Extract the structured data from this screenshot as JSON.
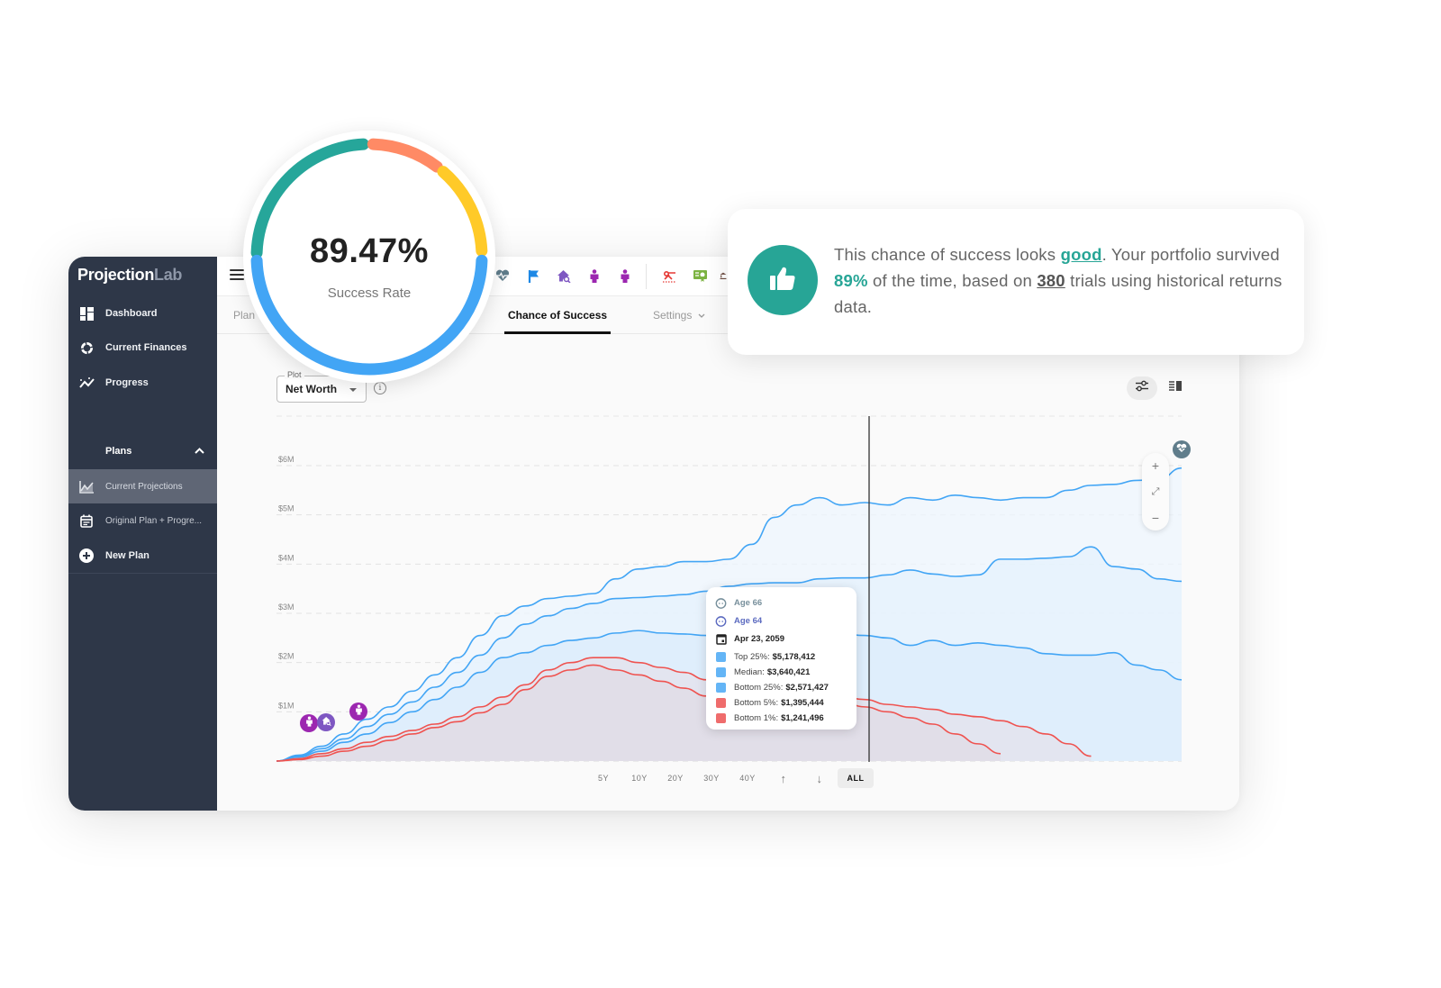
{
  "app": {
    "brand_main": "Projection",
    "brand_accent": "Lab"
  },
  "sidebar": {
    "items": [
      {
        "label": "Dashboard",
        "icon": "dashboard-icon"
      },
      {
        "label": "Current Finances",
        "icon": "donut-icon"
      },
      {
        "label": "Progress",
        "icon": "progress-icon"
      }
    ],
    "plans_header": "Plans",
    "plans": [
      {
        "label": "Current Projections",
        "icon": "chart-area-icon",
        "active": true
      },
      {
        "label": "Original Plan + Progre...",
        "icon": "calendar-icon",
        "active": false
      },
      {
        "label": "New Plan",
        "icon": "plus-circle-icon",
        "active": false
      }
    ]
  },
  "toolbar": {
    "icons": [
      "heart-pulse-icon",
      "flag-icon",
      "house-search-icon",
      "person-icon",
      "person-icon",
      "scissors-icon",
      "certificate-icon"
    ]
  },
  "tabs": [
    {
      "label": "Plan",
      "active": false
    },
    {
      "label": "Chance of Success",
      "active": true
    },
    {
      "label": "Settings",
      "active": false
    }
  ],
  "plot_select": {
    "legend": "Plot",
    "value": "Net Worth"
  },
  "gauge": {
    "value": "89.47%",
    "label": "Success Rate",
    "segments": [
      {
        "color": "#26a69a",
        "name": "teal"
      },
      {
        "color": "#ff8a65",
        "name": "orange"
      },
      {
        "color": "#ffca28",
        "name": "yellow"
      },
      {
        "color": "#42a5f5",
        "name": "blue"
      }
    ]
  },
  "message": {
    "part1": "This chance of success looks ",
    "rating": "good",
    "part2": ". Your portfolio survived ",
    "percent": "89%",
    "part3": " of the time, based on ",
    "trials": "380",
    "part4": " trials using historical returns data."
  },
  "range_buttons": [
    {
      "label": "5Y",
      "active": false
    },
    {
      "label": "10Y",
      "active": false
    },
    {
      "label": "20Y",
      "active": false
    },
    {
      "label": "30Y",
      "active": false
    },
    {
      "label": "40Y",
      "active": false
    },
    {
      "label": "↑",
      "active": false
    },
    {
      "label": "↓",
      "active": false
    },
    {
      "label": "ALL",
      "active": true
    }
  ],
  "zoom_controls": {
    "plus": "+",
    "fit": "⤢",
    "minus": "−"
  },
  "tooltip": {
    "age1": "Age 66",
    "age2": "Age 64",
    "date": "Apr 23, 2059",
    "rows": [
      {
        "label": "Top 25%:",
        "value": "$5,178,412",
        "color": "#64b5f6"
      },
      {
        "label": "Median:",
        "value": "$3,640,421",
        "color": "#64b5f6"
      },
      {
        "label": "Bottom 25%:",
        "value": "$2,571,427",
        "color": "#64b5f6"
      },
      {
        "label": "Bottom 5%:",
        "value": "$1,395,444",
        "color": "#ef6c6c"
      },
      {
        "label": "Bottom 1%:",
        "value": "$1,241,496",
        "color": "#ef6c6c"
      }
    ]
  },
  "chart_data": {
    "type": "area",
    "title": "",
    "xlabel": "",
    "ylabel": "Net Worth",
    "ylim": [
      0,
      6000000
    ],
    "yticks": [
      "$1M",
      "$2M",
      "$3M",
      "$4M",
      "$5M",
      "$6M"
    ],
    "ytick_values": [
      1000000,
      2000000,
      3000000,
      4000000,
      5000000,
      6000000
    ],
    "grid": true,
    "cursor_index": 26,
    "series": [
      {
        "name": "Top 25%",
        "color": "#42a5f5",
        "values": [
          0,
          0.12,
          0.3,
          0.55,
          0.85,
          1.1,
          1.42,
          1.75,
          2.1,
          2.55,
          2.95,
          3.15,
          3.3,
          3.35,
          3.4,
          3.7,
          3.9,
          3.95,
          4.05,
          4.05,
          4.1,
          4.4,
          4.95,
          5.2,
          5.35,
          5.2,
          5.25,
          5.2,
          5.35,
          5.3,
          5.4,
          5.35,
          5.3,
          5.35,
          5.35,
          5.5,
          5.6,
          5.62,
          5.7,
          5.72,
          5.95
        ]
      },
      {
        "name": "Median",
        "color": "#42a5f5",
        "values": [
          0,
          0.1,
          0.25,
          0.45,
          0.7,
          0.95,
          1.2,
          1.5,
          1.8,
          2.15,
          2.5,
          2.78,
          2.95,
          3.1,
          3.2,
          3.3,
          3.32,
          3.35,
          3.38,
          3.45,
          3.55,
          3.6,
          3.62,
          3.62,
          3.7,
          3.72,
          3.72,
          3.78,
          3.88,
          3.8,
          3.75,
          3.78,
          4.1,
          4.1,
          4.12,
          4.15,
          4.35,
          3.95,
          3.9,
          3.7,
          3.65
        ]
      },
      {
        "name": "Bottom 25%",
        "color": "#42a5f5",
        "values": [
          0,
          0.08,
          0.2,
          0.38,
          0.55,
          0.78,
          1.0,
          1.25,
          1.5,
          1.8,
          2.1,
          2.2,
          2.35,
          2.45,
          2.5,
          2.6,
          2.65,
          2.6,
          2.58,
          2.55,
          2.55,
          2.6,
          2.62,
          2.58,
          2.6,
          2.58,
          2.55,
          2.5,
          2.35,
          2.45,
          2.35,
          2.4,
          2.35,
          2.3,
          2.18,
          2.15,
          2.15,
          2.2,
          1.95,
          1.85,
          1.65
        ]
      },
      {
        "name": "Bottom 5%",
        "color": "#ef5350",
        "values": [
          0,
          0.05,
          0.15,
          0.25,
          0.38,
          0.5,
          0.62,
          0.75,
          0.9,
          1.1,
          1.3,
          1.55,
          1.85,
          2.0,
          2.1,
          2.1,
          2.0,
          1.9,
          1.8,
          1.65,
          1.5,
          1.42,
          1.38,
          1.4,
          1.38,
          1.3,
          1.25,
          1.15,
          1.1,
          1.05,
          0.95,
          0.9,
          0.82,
          0.7,
          0.55,
          0.35,
          0.1,
          null,
          null,
          null,
          null
        ]
      },
      {
        "name": "Bottom 1%",
        "color": "#ef5350",
        "values": [
          0,
          0.03,
          0.1,
          0.2,
          0.3,
          0.42,
          0.55,
          0.68,
          0.8,
          0.98,
          1.15,
          1.45,
          1.72,
          1.85,
          1.95,
          1.85,
          1.75,
          1.62,
          1.48,
          1.32,
          1.22,
          1.2,
          1.25,
          1.28,
          1.25,
          1.2,
          1.1,
          1.0,
          0.88,
          0.75,
          0.55,
          0.35,
          0.15,
          null,
          null,
          null,
          null,
          null,
          null,
          null,
          null
        ]
      }
    ]
  },
  "milestones": [
    "person-icon",
    "house-search-icon",
    "person-icon"
  ]
}
